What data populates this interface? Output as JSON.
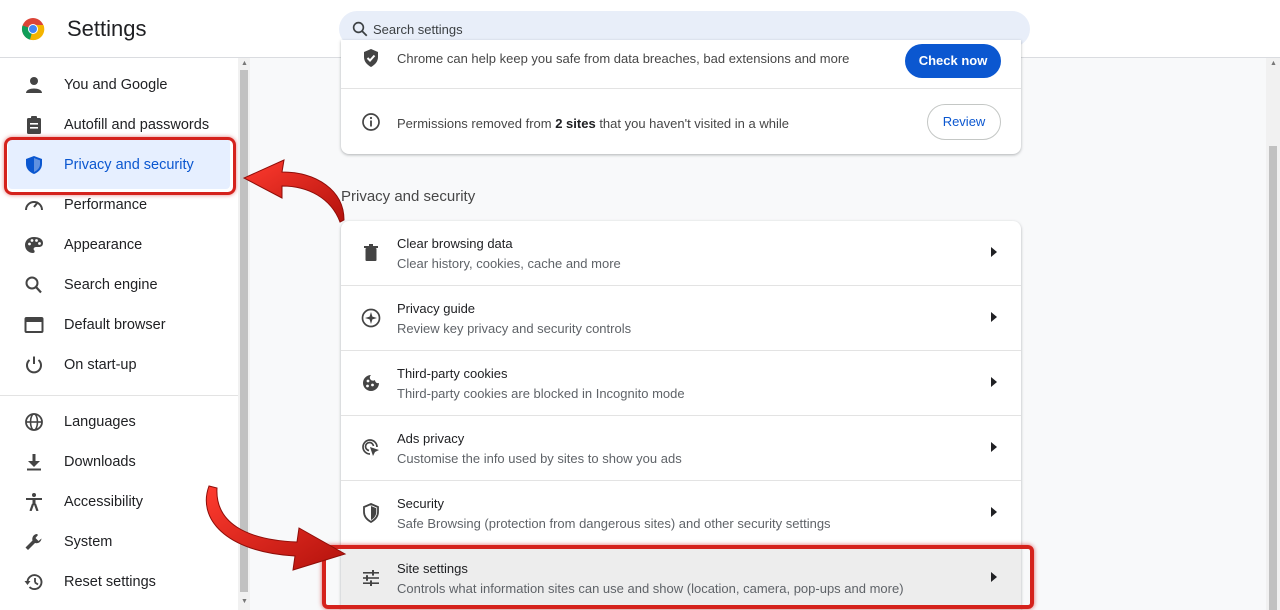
{
  "header": {
    "title": "Settings",
    "search_placeholder": "Search settings"
  },
  "sidebar": {
    "items": [
      {
        "label": "You and Google",
        "icon": "person-icon"
      },
      {
        "label": "Autofill and passwords",
        "icon": "clipboard-icon"
      },
      {
        "label": "Privacy and security",
        "icon": "shield-icon",
        "active": true
      },
      {
        "label": "Performance",
        "icon": "speedometer-icon"
      },
      {
        "label": "Appearance",
        "icon": "palette-icon"
      },
      {
        "label": "Search engine",
        "icon": "search-icon"
      },
      {
        "label": "Default browser",
        "icon": "browser-window-icon"
      },
      {
        "label": "On start-up",
        "icon": "power-icon"
      },
      {
        "label": "Languages",
        "icon": "globe-icon"
      },
      {
        "label": "Downloads",
        "icon": "download-icon"
      },
      {
        "label": "Accessibility",
        "icon": "accessibility-icon"
      },
      {
        "label": "System",
        "icon": "wrench-icon"
      },
      {
        "label": "Reset settings",
        "icon": "history-icon"
      }
    ]
  },
  "safety_card": {
    "partial_text": "Chrome can help keep you safe from data breaches, bad extensions and more",
    "check_now_label": "Check now",
    "permissions_prefix": "Permissions removed from ",
    "permissions_bold": "2 sites",
    "permissions_suffix": " that you haven't visited in a while",
    "review_label": "Review"
  },
  "privacy": {
    "section_title": "Privacy and security",
    "rows": [
      {
        "title": "Clear browsing data",
        "subtitle": "Clear history, cookies, cache and more",
        "icon": "trash-icon"
      },
      {
        "title": "Privacy guide",
        "subtitle": "Review key privacy and security controls",
        "icon": "privacy-guide-icon"
      },
      {
        "title": "Third-party cookies",
        "subtitle": "Third-party cookies are blocked in Incognito mode",
        "icon": "cookie-icon"
      },
      {
        "title": "Ads privacy",
        "subtitle": "Customise the info used by sites to show you ads",
        "icon": "ads-privacy-icon"
      },
      {
        "title": "Security",
        "subtitle": "Safe Browsing (protection from dangerous sites) and other security settings",
        "icon": "security-shield-icon"
      },
      {
        "title": "Site settings",
        "subtitle": "Controls what information sites can use and show (location, camera, pop-ups and more)",
        "icon": "sliders-icon"
      }
    ]
  },
  "colors": {
    "accent": "#0b57d0",
    "highlight_red": "#d5221c",
    "active_bg": "#e6efff"
  }
}
